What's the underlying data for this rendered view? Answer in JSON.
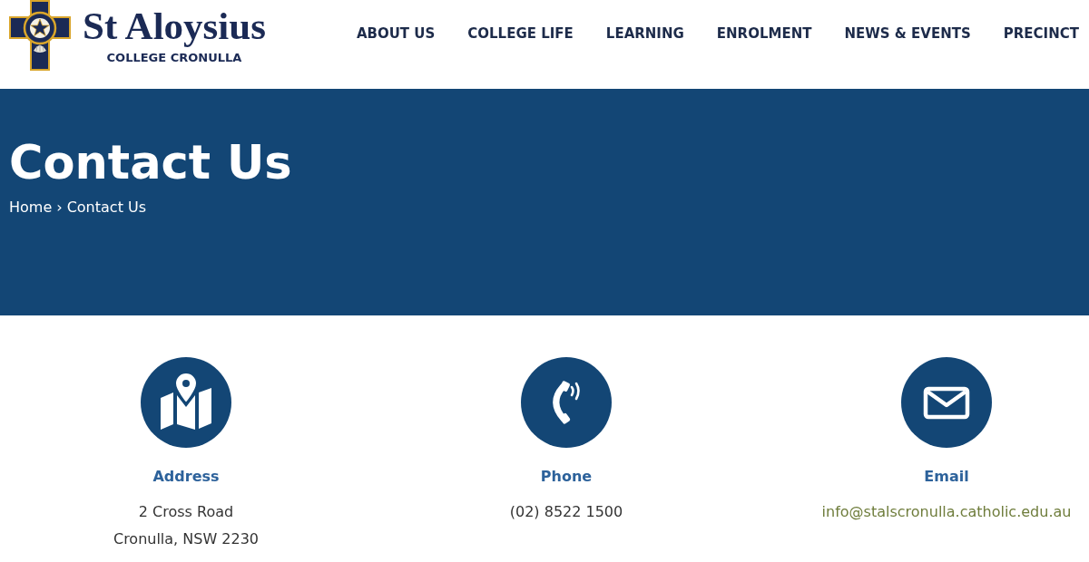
{
  "header": {
    "logo": {
      "name": "St Aloysius",
      "subtitle": "COLLEGE CRONULLA"
    },
    "nav": [
      {
        "label": "ABOUT US"
      },
      {
        "label": "COLLEGE LIFE"
      },
      {
        "label": "LEARNING"
      },
      {
        "label": "ENROLMENT"
      },
      {
        "label": "NEWS & EVENTS"
      },
      {
        "label": "PRECINCT"
      }
    ]
  },
  "banner": {
    "title": "Contact Us",
    "breadcrumb": {
      "links": [
        {
          "label": "Home"
        }
      ],
      "separator": "›",
      "current": "Contact Us"
    }
  },
  "contacts": [
    {
      "kind": "address",
      "heading": "Address",
      "lines": [
        "2 Cross Road",
        "Cronulla, NSW 2230"
      ]
    },
    {
      "kind": "phone",
      "heading": "Phone",
      "lines": [
        "(02) 8522 1500"
      ]
    },
    {
      "kind": "email",
      "heading": "Email",
      "lines": [
        "info@stalscronulla.catholic.edu.au"
      ]
    }
  ]
}
